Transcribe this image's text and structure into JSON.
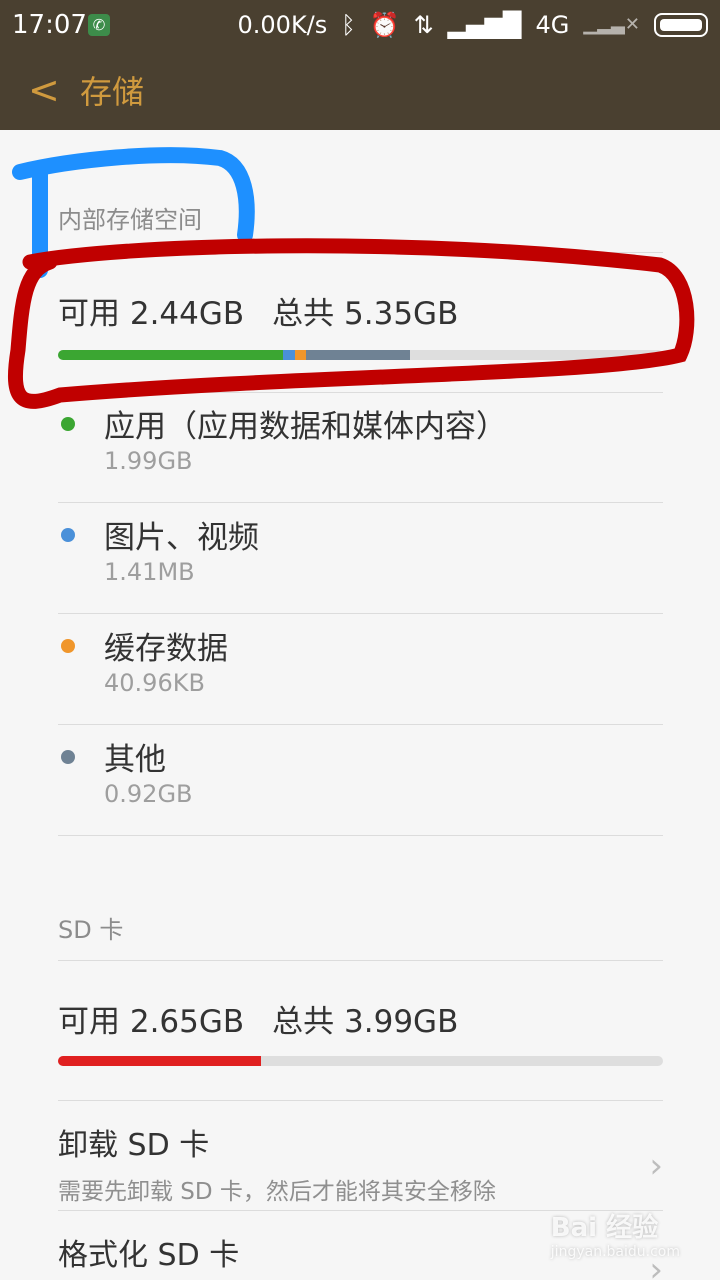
{
  "status_bar": {
    "time": "17:07",
    "network_speed": "0.00K/s",
    "network_type": "4G",
    "icons": [
      "phone-icon",
      "bluetooth-icon",
      "alarm-icon",
      "data-transfer-icon",
      "signal-icon",
      "no-signal-icon",
      "battery-icon"
    ]
  },
  "header": {
    "title": "存储"
  },
  "internal": {
    "section_label": "内部存储空间",
    "available": "可用 2.44GB",
    "total": "总共 5.35GB",
    "usage": [
      {
        "name": "应用（应用数据和媒体内容）",
        "size": "1.99GB",
        "color": "#3ba632",
        "fraction": 0.3719
      },
      {
        "name": "图片、视频",
        "size": "1.41MB",
        "color": "#4a90d9",
        "fraction": 0.02
      },
      {
        "name": "缓存数据",
        "size": "40.96KB",
        "color": "#f0962b",
        "fraction": 0.018
      },
      {
        "name": "其他",
        "size": "0.92GB",
        "color": "#6f8294",
        "fraction": 0.172
      }
    ]
  },
  "sd": {
    "section_label": "SD 卡",
    "available": "可用 2.65GB",
    "total": "总共 3.99GB",
    "used_fraction": 0.336,
    "used_color": "#e02020"
  },
  "actions": [
    {
      "title": "卸载 SD 卡",
      "subtitle": "需要先卸载 SD 卡，然后才能将其安全移除"
    },
    {
      "title": "格式化 SD 卡",
      "subtitle": ""
    }
  ],
  "watermark": {
    "text": "Bai 经验",
    "url_text": "jingyan.baidu.com"
  },
  "colors": {
    "header_bg": "#4a4030",
    "accent": "#d09a3e",
    "annotation_blue": "#1e90ff",
    "annotation_red": "#c00000"
  }
}
